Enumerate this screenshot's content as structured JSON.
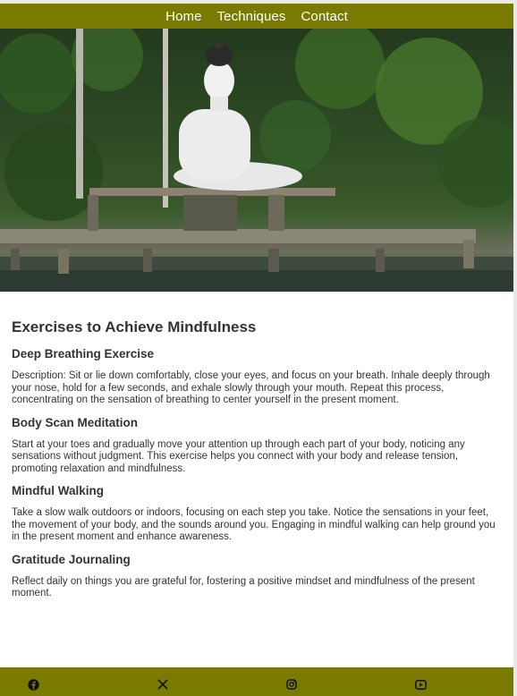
{
  "nav": {
    "items": [
      {
        "label": "Home"
      },
      {
        "label": "Techniques"
      },
      {
        "label": "Contact"
      }
    ]
  },
  "hero": {
    "image": "buddha-statue-on-pier-by-water"
  },
  "main": {
    "title": "Exercises to Achieve Mindfulness",
    "sections": [
      {
        "heading": "Deep Breathing Exercise",
        "text": "Description: Sit or lie down comfortably, close your eyes, and focus on your breath. Inhale deeply through your nose, hold for a few seconds, and exhale slowly through your mouth. Repeat this process, concentrating on the sensation of breathing to center yourself in the present moment."
      },
      {
        "heading": "Body Scan Meditation",
        "text": "Start at your toes and gradually move your attention up through each part of your body, noticing any sensations without judgment. This exercise helps you connect with your body and release tension, promoting relaxation and mindfulness."
      },
      {
        "heading": "Mindful Walking",
        "text": "Take a slow walk outdoors or indoors, focusing on each step you take. Notice the sensations in your feet, the movement of your body, and the sounds around you. Engaging in mindful walking can help ground you in the present moment and enhance awareness."
      },
      {
        "heading": "Gratitude Journaling",
        "text": "Reflect daily on things you are grateful for, fostering a positive mindset and mindfulness of the present moment."
      }
    ]
  },
  "footer": {
    "icons": [
      "facebook-icon",
      "x-twitter-icon",
      "instagram-icon",
      "youtube-icon"
    ]
  },
  "colors": {
    "brand": "#7a7a00",
    "text": "#333333"
  }
}
